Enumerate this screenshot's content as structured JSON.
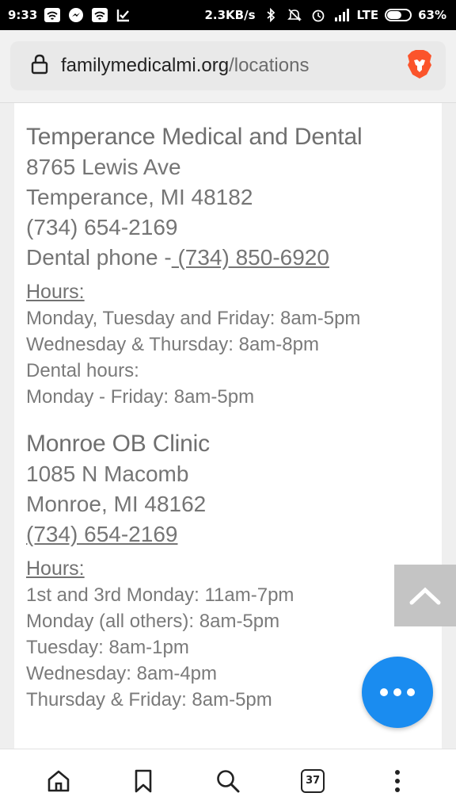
{
  "status_bar": {
    "time": "9:33",
    "speed": "2.3KB/s",
    "network": "LTE",
    "battery_percent_label": "63%",
    "battery_level": 0.63
  },
  "browser": {
    "url_domain": "familymedicalmi.org",
    "url_path": "/locations",
    "tab_count": "37"
  },
  "locations": [
    {
      "name": "Temperance Medical and Dental",
      "address_line1": "8765 Lewis Ave",
      "address_line2": "Temperance, MI 48182",
      "phone": "(734) 654-2169",
      "dental_phone_label": "Dental phone -",
      "dental_phone": " (734) 850-6920",
      "hours_label": "Hours:",
      "hours": [
        "Monday, Tuesday and Friday: 8am-5pm",
        "Wednesday & Thursday: 8am-8pm",
        "Dental hours:",
        "Monday - Friday: 8am-5pm"
      ]
    },
    {
      "name": "Monroe OB Clinic",
      "address_line1": "1085 N Macomb",
      "address_line2": "Monroe, MI 48162",
      "phone": "(734) 654-2169",
      "hours_label": "Hours:",
      "hours": [
        "1st and 3rd Monday: 11am-7pm",
        "Monday (all others): 8am-5pm",
        "Tuesday: 8am-1pm",
        "Wednesday: 8am-4pm",
        "Thursday & Friday: 8am-5pm"
      ]
    }
  ],
  "colors": {
    "fab_blue": "#1a8cf0",
    "back_to_top_gray": "#c4c4c4",
    "brave_orange": "#fb542b"
  }
}
